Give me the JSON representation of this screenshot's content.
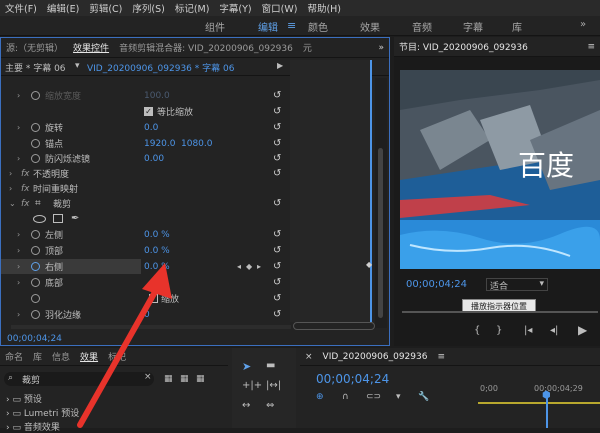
{
  "menu": [
    "文件(F)",
    "编辑(E)",
    "剪辑(C)",
    "序列(S)",
    "标记(M)",
    "字幕(Y)",
    "窗口(W)",
    "帮助(H)"
  ],
  "workspaces": [
    "组件",
    "编辑",
    "颜色",
    "效果",
    "音频",
    "字幕",
    "库"
  ],
  "effect_panel": {
    "tabs": [
      "源:（无剪辑）",
      "效果控件",
      "音频剪辑混合器: VID_20200906_092936",
      "元"
    ],
    "clip_path": "主要 * 字幕 06",
    "clip_active": "VID_20200906_092936 * 字幕 06",
    "rows": {
      "scale_width": {
        "label": "缩放宽度",
        "value": "100.0"
      },
      "uniform": {
        "label": "等比缩放"
      },
      "rotation": {
        "label": "旋转",
        "value": "0.0"
      },
      "anchor": {
        "label": "锚点",
        "v1": "1920.0",
        "v2": "1080.0"
      },
      "flicker": {
        "label": "防闪烁滤镜",
        "value": "0.00"
      },
      "opacity": {
        "label": "不透明度"
      },
      "timeremap": {
        "label": "时间重映射"
      },
      "crop": {
        "label": "裁剪"
      },
      "left": {
        "label": "左侧",
        "value": "0.0 %"
      },
      "top": {
        "label": "顶部",
        "value": "0.0 %"
      },
      "right": {
        "label": "右侧",
        "value": "0.0 %"
      },
      "bottom": {
        "label": "底部"
      },
      "zoom": {
        "label": "缩放"
      },
      "feather": {
        "label": "羽化边缘",
        "value": "0"
      }
    },
    "timecode": "00;00;04;24"
  },
  "program": {
    "title": "节目: VID_20200906_092936",
    "overlay_text": "百度",
    "timecode": "00;00;04;24",
    "fit": "适合",
    "tooltip": "播放指示器位置"
  },
  "project_panel": {
    "tabs": [
      "命名",
      "库",
      "信息",
      "效果",
      "标记"
    ],
    "search_value": "裁剪",
    "items": [
      "预设",
      "Lumetri 预设",
      "音频效果"
    ]
  },
  "timeline": {
    "title": "VID_20200906_092936",
    "timecode": "00;00;04;24",
    "ruler": [
      "0;00",
      "00;00;04;29"
    ]
  },
  "colors": {
    "accent": "#4d95e8",
    "arrow": "#e8332b",
    "active_tab": "#5fa0e8"
  }
}
